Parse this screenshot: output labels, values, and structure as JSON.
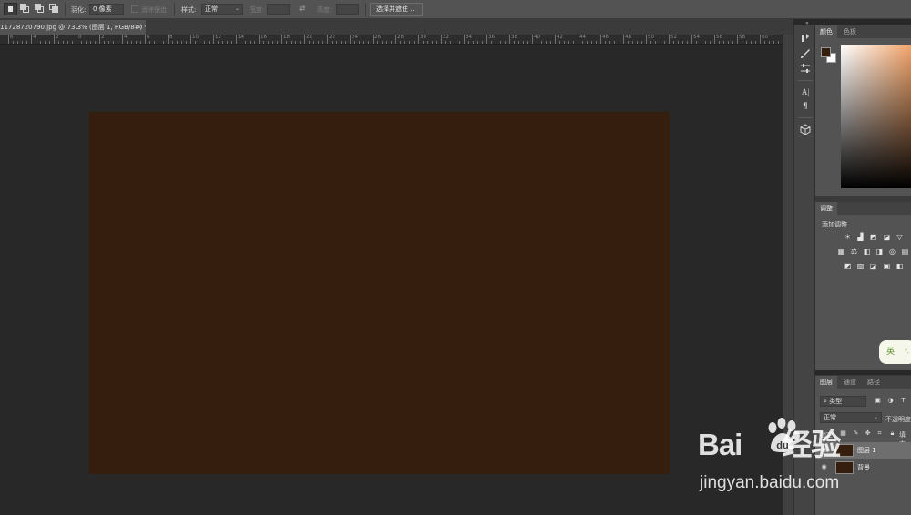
{
  "options_bar": {
    "feather_label": "羽化:",
    "feather_value": "0 像素",
    "antialias_label": "消除锯齿",
    "style_label": "样式:",
    "style_value": "正常",
    "width_label": "宽度:",
    "height_label": "高度:",
    "select_mask_button": "选择并遮住 ..."
  },
  "document_tab": {
    "title": "11728720790.jpg @ 73.3% (图层 1, RGB/8#) *",
    "close": "×"
  },
  "ruler": {
    "labels": [
      "6",
      "4",
      "2",
      "0",
      "2",
      "4",
      "6",
      "8",
      "10",
      "12",
      "14",
      "16",
      "18",
      "20",
      "22",
      "24",
      "26",
      "28",
      "30",
      "32",
      "34",
      "36",
      "38",
      "40",
      "42",
      "44",
      "46",
      "48",
      "50",
      "52",
      "54",
      "56",
      "58",
      "60",
      "62",
      "64",
      "66"
    ]
  },
  "document": {
    "fill_color": "#361e0e"
  },
  "toolstrip": {
    "tools": [
      "history-brush-icon",
      "brush-settings-icon",
      "adjust-sliders-icon",
      "character-icon",
      "paragraph-icon",
      "3d-icon"
    ]
  },
  "color_panel": {
    "tabs": [
      "颜色",
      "色板"
    ],
    "foreground": "#361e0e",
    "background": "#ffffff"
  },
  "adjustments_panel": {
    "tab": "调整",
    "title": "添加调整",
    "ime_label": "英"
  },
  "layers_panel": {
    "tabs": [
      "图层",
      "通道",
      "路径"
    ],
    "filter_label": "类型",
    "blend_mode": "正常",
    "opacity_label": "不透明度",
    "lock_label": "锁定:",
    "fill_label": "填充",
    "layers": [
      {
        "name": "图层 1",
        "selected": true
      },
      {
        "name": "背景",
        "selected": false
      }
    ]
  },
  "watermark": {
    "logo_text": "Bai",
    "logo_suffix": "经验",
    "url": "jingyan.baidu.com"
  }
}
